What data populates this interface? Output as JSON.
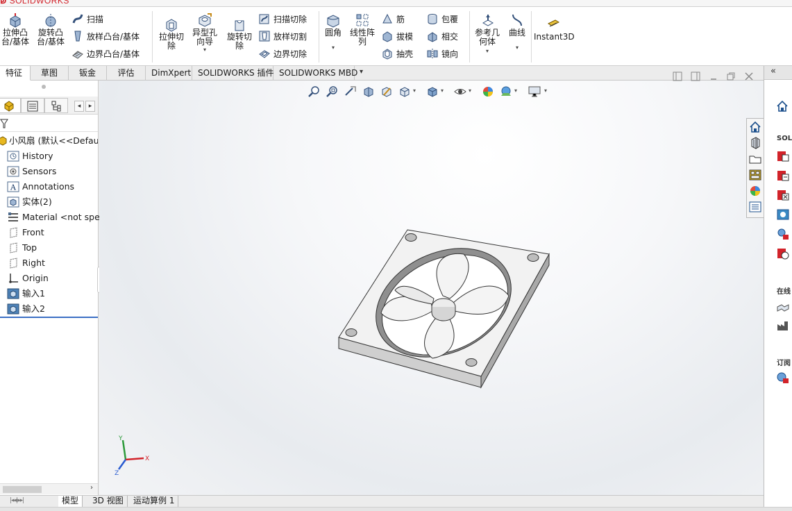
{
  "app": {
    "logo_text": "SOLIDWORKS"
  },
  "ribbon": {
    "extrude_boss": "拉伸凸台/基体",
    "revolve_boss": "旋转凸台/基体",
    "sweep": "扫描",
    "loft_boss": "放样凸台/基体",
    "boundary_boss": "边界凸台/基体",
    "extrude_cut": "拉伸切除",
    "hole_wizard": "异型孔向导",
    "revolve_cut": "旋转切除",
    "sweep_cut": "扫描切除",
    "loft_cut": "放样切割",
    "boundary_cut": "边界切除",
    "fillet": "圆角",
    "linear_pattern": "线性阵列",
    "rib": "筋",
    "draft": "拔模",
    "shell": "抽壳",
    "wrap": "包覆",
    "intersect": "相交",
    "mirror": "镜向",
    "ref_geometry": "参考几何体",
    "curves": "曲线",
    "instant3d": "Instant3D"
  },
  "tabs": [
    {
      "label": "特征"
    },
    {
      "label": "草图"
    },
    {
      "label": "钣金"
    },
    {
      "label": "评估"
    },
    {
      "label": "DimXpert"
    },
    {
      "label": "SOLIDWORKS 插件"
    },
    {
      "label": "SOLIDWORKS MBD"
    }
  ],
  "tree": {
    "root": "小风扇 (默认<<Default",
    "items": [
      {
        "label": "History",
        "icon": "history-icon"
      },
      {
        "label": "Sensors",
        "icon": "sensors-icon"
      },
      {
        "label": "Annotations",
        "icon": "annotations-icon"
      },
      {
        "label": "实体(2)",
        "icon": "solid-bodies-icon"
      },
      {
        "label": "Material <not spe",
        "icon": "material-icon"
      },
      {
        "label": "Front",
        "icon": "plane-icon"
      },
      {
        "label": "Top",
        "icon": "plane-icon"
      },
      {
        "label": "Right",
        "icon": "plane-icon"
      },
      {
        "label": "Origin",
        "icon": "origin-icon"
      },
      {
        "label": "输入1",
        "icon": "imported-body-icon"
      },
      {
        "label": "输入2",
        "icon": "imported-body-icon"
      }
    ]
  },
  "triad": {
    "x": "X",
    "y": "Y",
    "z": "Z"
  },
  "bottom_tabs": [
    {
      "label": "模型"
    },
    {
      "label": "3D 视图"
    },
    {
      "label": "运动算例 1"
    }
  ],
  "taskpane": {
    "solidworks_resources": "SOLI",
    "online": "在线",
    "subscription": "订阅"
  },
  "colors": {
    "accent": "#d2232a",
    "selection_blue": "#3b6fc4"
  }
}
